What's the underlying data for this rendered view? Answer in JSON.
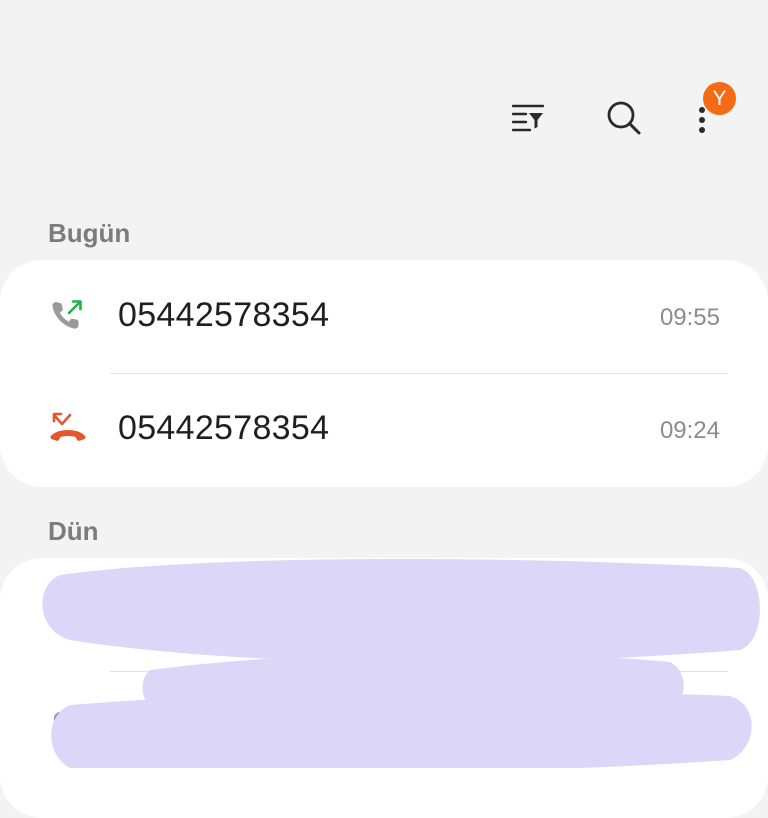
{
  "toolbar": {
    "filter_icon": "filter-list-icon",
    "search_icon": "search-icon",
    "more_icon": "more-vertical-icon",
    "badge_text": "Y",
    "badge_color": "#f36b14"
  },
  "sections": [
    {
      "label": "Bugün",
      "calls": [
        {
          "icon": "outgoing-call-icon",
          "icon_color": "#1fb24a",
          "number": "05442578354",
          "time": "09:55"
        },
        {
          "icon": "missed-call-icon",
          "icon_color": "#e4572e",
          "number": "05442578354",
          "time": "09:24"
        }
      ]
    },
    {
      "label": "Dün",
      "calls": []
    }
  ],
  "redaction_color": "#dcd7f8"
}
